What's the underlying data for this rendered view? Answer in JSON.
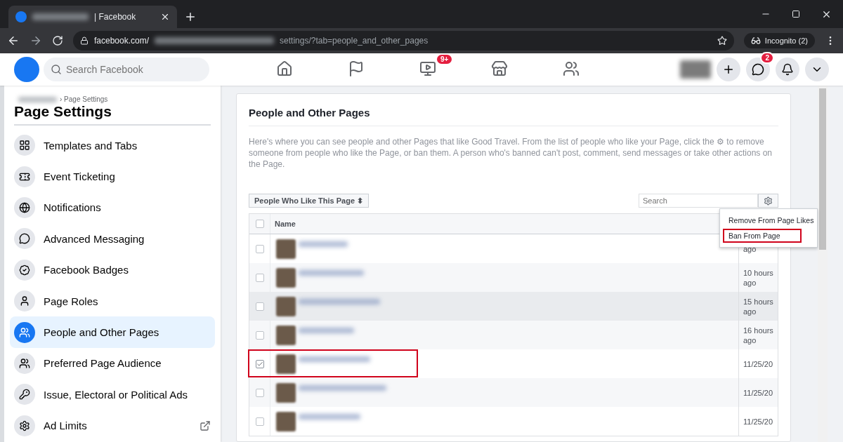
{
  "browser": {
    "tab_title": "| Facebook",
    "url_domain": "facebook.com/",
    "url_path": "settings/?tab=people_and_other_pages",
    "incognito": "Incognito (2)"
  },
  "topbar": {
    "search_placeholder": "Search Facebook",
    "nav": [
      {
        "kind": "home",
        "selected": false
      },
      {
        "kind": "flag",
        "selected": false
      },
      {
        "kind": "video",
        "selected": false,
        "badge": "9+"
      },
      {
        "kind": "store",
        "selected": false
      },
      {
        "kind": "groups",
        "selected": false
      }
    ],
    "messenger_badge": "2"
  },
  "sidebar": {
    "breadcrumb": "› Page Settings",
    "title": "Page Settings",
    "items": [
      {
        "kind": "grid",
        "label": "Templates and Tabs",
        "selected": false
      },
      {
        "kind": "ticket",
        "label": "Event Ticketing",
        "selected": false
      },
      {
        "kind": "globe",
        "label": "Notifications",
        "selected": false
      },
      {
        "kind": "messenger",
        "label": "Advanced Messaging",
        "selected": false
      },
      {
        "kind": "badge",
        "label": "Facebook Badges",
        "selected": false
      },
      {
        "kind": "person",
        "label": "Page Roles",
        "selected": false
      },
      {
        "kind": "people",
        "label": "People and Other Pages",
        "selected": true
      },
      {
        "kind": "people",
        "label": "Preferred Page Audience",
        "selected": false
      },
      {
        "kind": "key",
        "label": "Issue, Electoral or Political Ads",
        "selected": false
      },
      {
        "kind": "gear",
        "label": "Ad Limits",
        "selected": false,
        "external": true
      }
    ]
  },
  "main": {
    "title": "People and Other Pages",
    "description": "Here's where you can see people and other Pages that like Good Travel. From the list of people who like your Page, click the ⚙ to remove someone from people who like the Page, or ban them. A person who's banned can't post, comment, send messages or take other actions on the Page.",
    "filter": "People Who Like This Page ⬍",
    "search_placeholder": "Search",
    "menu": [
      {
        "label": "Remove From Page Likes",
        "highlighted": false
      },
      {
        "label": "Ban From Page",
        "highlighted": true
      }
    ],
    "table": {
      "header": "Name",
      "all_checked": false,
      "rows": [
        {
          "checked": false,
          "highlighted": false,
          "hovered": false,
          "time": "ago"
        },
        {
          "checked": false,
          "highlighted": false,
          "hovered": false,
          "time": "10 hours ago"
        },
        {
          "checked": false,
          "highlighted": false,
          "hovered": true,
          "time": "15 hours ago"
        },
        {
          "checked": false,
          "highlighted": false,
          "hovered": false,
          "time": "16 hours ago"
        },
        {
          "checked": true,
          "highlighted": true,
          "hovered": false,
          "time": "11/25/20"
        },
        {
          "checked": false,
          "highlighted": false,
          "hovered": false,
          "time": "11/25/20"
        },
        {
          "checked": false,
          "highlighted": false,
          "hovered": false,
          "time": "11/25/20"
        }
      ]
    }
  }
}
